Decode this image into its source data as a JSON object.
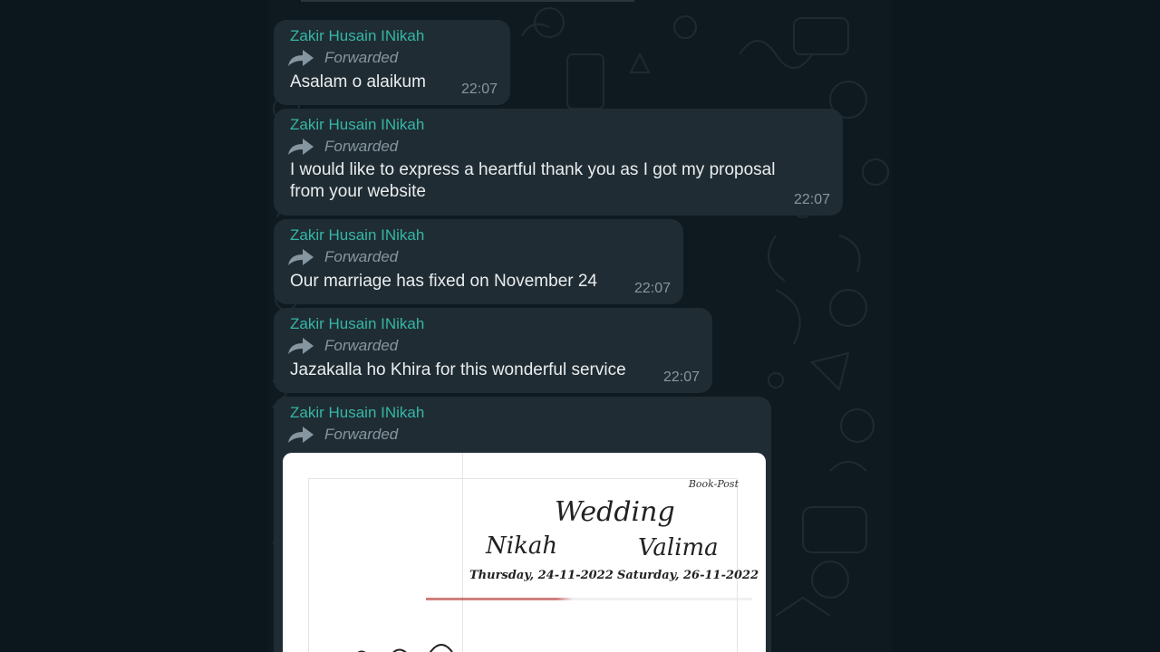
{
  "chat": {
    "messages": [
      {
        "sender": "Zakir Husain INikah",
        "forwarded_label": "Forwarded",
        "text": "Asalam o alaikum",
        "time": "22:07"
      },
      {
        "sender": "Zakir Husain INikah",
        "forwarded_label": "Forwarded",
        "text_lines": [
          "I would like to express a heartful thank you as I got my proposal",
          "from your website"
        ],
        "time": "22:07"
      },
      {
        "sender": "Zakir Husain INikah",
        "forwarded_label": "Forwarded",
        "text": "Our marriage has fixed on November 24",
        "time": "22:07"
      },
      {
        "sender": "Zakir Husain INikah",
        "forwarded_label": "Forwarded",
        "text": "Jazakalla ho Khira for this wonderful service",
        "time": "22:07"
      },
      {
        "sender": "Zakir Husain INikah",
        "forwarded_label": "Forwarded",
        "image": {
          "book_post": "Book-Post",
          "title": "Wedding",
          "nikah": "Nikah",
          "nikah_date": "Thursday, 24-11-2022",
          "valima": "Valima",
          "valima_date": "Saturday, 26-11-2022"
        }
      }
    ]
  },
  "icons": {
    "forward": "forward-arrow-icon"
  },
  "colors": {
    "background": "#0c161d",
    "bubble": "#202c33",
    "sender_name": "#34b7a7",
    "meta": "#8696a0",
    "text": "#e9edef"
  }
}
